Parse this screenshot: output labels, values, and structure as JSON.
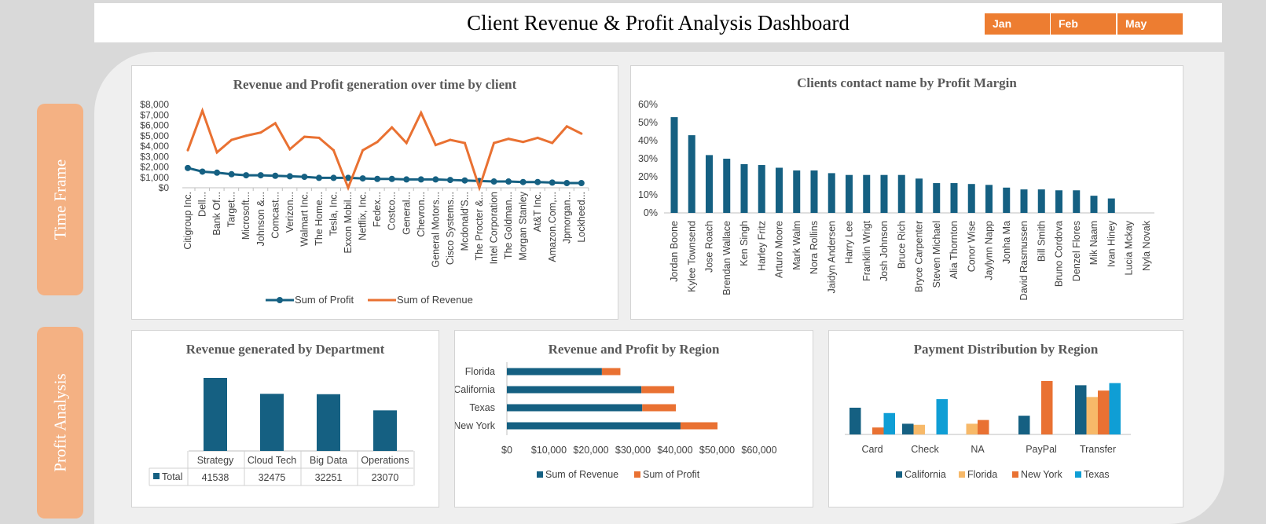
{
  "header": {
    "title": "Client Revenue & Profit Analysis Dashboard",
    "slicer": [
      "Jan",
      "Feb",
      "May"
    ]
  },
  "side_tabs": [
    "Time Frame",
    "Profit Analysis"
  ],
  "colors": {
    "blue": "#156082",
    "orange": "#e97132",
    "light_orange": "#f4b183",
    "slicer_orange": "#ed7d31",
    "cyan": "#0f9ed5",
    "peach": "#f7b969"
  },
  "chart_data": [
    {
      "id": "line",
      "type": "line",
      "title": "Revenue and Profit generation over time by client",
      "categories": [
        "Citigroup Inc.",
        "Dell...",
        "Bank Of...",
        "Target...",
        "Microsoft...",
        "Johnson &...",
        "Comcast...",
        "Verizon...",
        "Walmart Inc.",
        "The Home...",
        "Tesla, Inc.",
        "Exxon Mobil...",
        "Netflix, Inc.",
        "Fedex...",
        "Costco...",
        "General...",
        "Chevron...",
        "General Motors...",
        "Cisco Systems...",
        "Mcdonald'S...",
        "The Procter &...",
        "Intel Corporation",
        "The Goldman...",
        "Morgan Stanley",
        "At&T Inc.",
        "Amazon.Com,...",
        "Jpmorgan...",
        "Lockheed..."
      ],
      "series": [
        {
          "name": "Sum of Profit",
          "values": [
            1900,
            1550,
            1450,
            1300,
            1200,
            1200,
            1150,
            1100,
            1050,
            950,
            950,
            950,
            900,
            850,
            850,
            800,
            800,
            800,
            750,
            700,
            650,
            600,
            600,
            550,
            550,
            500,
            450,
            450
          ]
        },
        {
          "name": "Sum of Revenue",
          "values": [
            3600,
            7400,
            3400,
            4600,
            5000,
            5300,
            6200,
            3700,
            4900,
            4800,
            3600,
            0,
            3600,
            4400,
            5800,
            4300,
            7200,
            4100,
            4600,
            4300,
            0,
            4300,
            4700,
            4400,
            4800,
            4300,
            5900,
            5200
          ]
        }
      ],
      "yticks": [
        "$0",
        "$1,000",
        "$2,000",
        "$3,000",
        "$4,000",
        "$5,000",
        "$6,000",
        "$7,000",
        "$8,000"
      ],
      "ylim": [
        0,
        8000
      ]
    },
    {
      "id": "margin",
      "type": "bar",
      "title": "Clients contact name by Profit Margin",
      "categories": [
        "Jordan Boone",
        "Kylee Townsend",
        "Jose Roach",
        "Brendan Wallace",
        "Ken Singh",
        "Harley Fritz",
        "Arturo Moore",
        "Mark Walm",
        "Nora Rollins",
        "Jaidyn Andersen",
        "Harry Lee",
        "Franklin Wrigt",
        "Josh Johnson",
        "Bruce Rich",
        "Bryce Carpenter",
        "Steven Michael",
        "Alia Thornton",
        "Conor Wise",
        "Jaylynn Napp",
        "Jonha Ma",
        "David Rasmussen",
        "Bill Smith",
        "Bruno Cordova",
        "Denzel Flores",
        "Mik Naam",
        "Ivan Hiney",
        "Lucia Mckay",
        "Nyla Novak"
      ],
      "values": [
        53,
        43,
        32,
        30,
        27,
        26.5,
        25,
        23.5,
        23.5,
        22,
        21,
        21,
        21,
        21,
        19,
        16.5,
        16.5,
        16,
        15.5,
        14,
        13,
        13,
        12.5,
        12.5,
        9.5,
        8,
        0,
        0
      ],
      "yticks": [
        "0%",
        "10%",
        "20%",
        "30%",
        "40%",
        "50%",
        "60%"
      ],
      "ylim": [
        0,
        60
      ]
    },
    {
      "id": "dept",
      "type": "bar",
      "title": "Revenue generated by Department",
      "categories": [
        "Strategy",
        "Cloud Tech",
        "Big Data",
        "Operations"
      ],
      "values": [
        41538,
        32475,
        32251,
        23070
      ],
      "legend": "Total",
      "ylim": [
        0,
        45000
      ]
    },
    {
      "id": "region",
      "type": "bar",
      "title": "Revenue and Profit  by Region",
      "categories": [
        "Florida",
        "California",
        "Texas",
        "New York"
      ],
      "series": [
        {
          "name": "Sum of Revenue",
          "values": [
            22600,
            32000,
            32200,
            41300
          ]
        },
        {
          "name": "Sum of Profit",
          "values": [
            4400,
            7800,
            8000,
            8800
          ]
        }
      ],
      "xticks": [
        "$0",
        "$10,000",
        "$20,000",
        "$30,000",
        "$40,000",
        "$50,000",
        "$60,000"
      ],
      "xlim": [
        0,
        60000
      ]
    },
    {
      "id": "payment",
      "type": "bar",
      "title": "Payment Distribution by Region",
      "categories": [
        "Card",
        "Check",
        "NA",
        "PayPal",
        "Transfer"
      ],
      "series": [
        {
          "name": "California",
          "values": [
            5,
            2,
            0,
            3.5,
            9.2
          ]
        },
        {
          "name": "Florida",
          "values": [
            0,
            1.8,
            2,
            0,
            7
          ]
        },
        {
          "name": "New York",
          "values": [
            1.3,
            0,
            2.7,
            10,
            8.2
          ]
        },
        {
          "name": "Texas",
          "values": [
            4,
            6.6,
            0,
            0,
            9.6
          ]
        }
      ],
      "ylim": [
        0,
        11
      ]
    }
  ]
}
